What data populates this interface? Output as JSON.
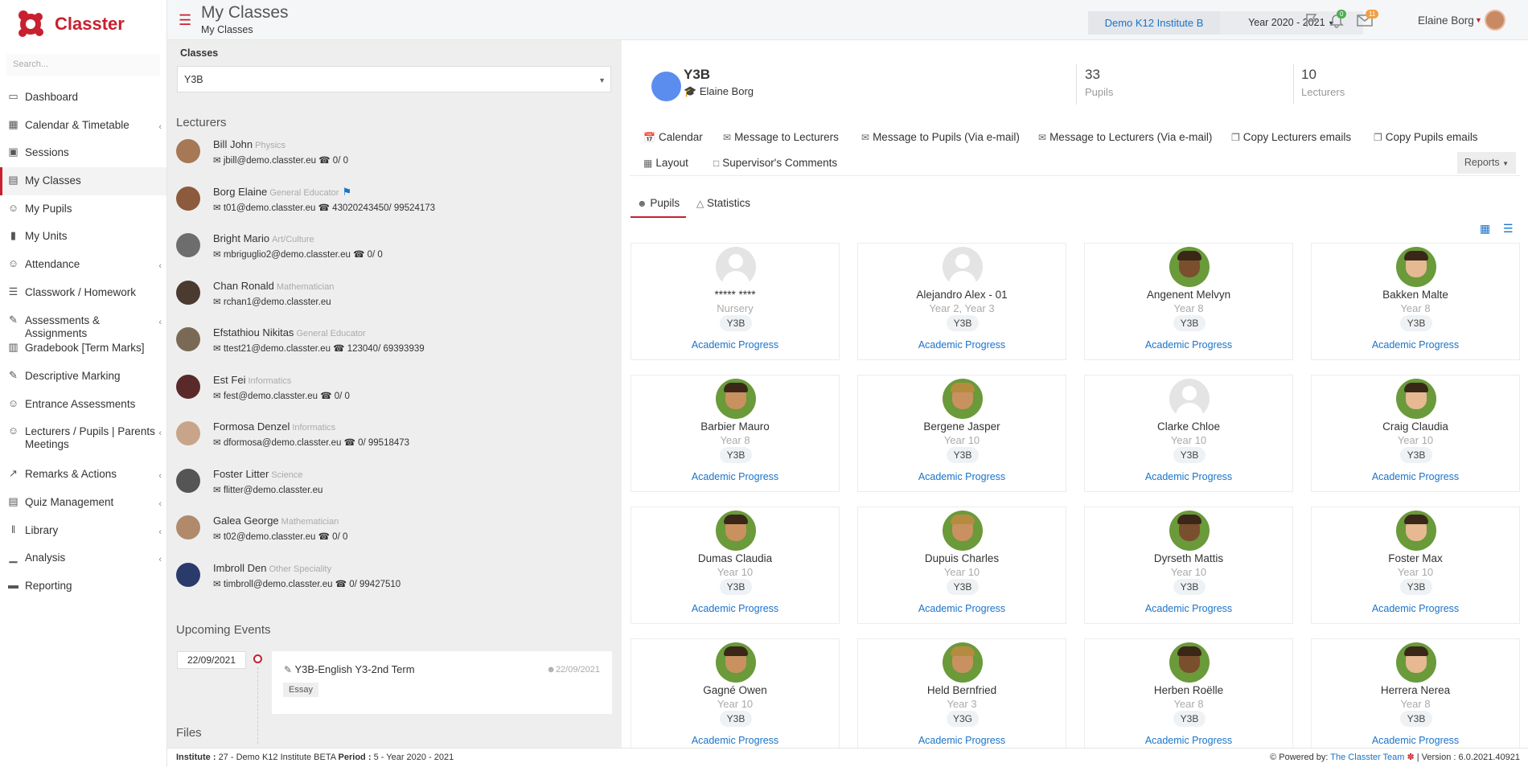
{
  "app": {
    "name": "Classter"
  },
  "search": {
    "placeholder": "Search..."
  },
  "sidebar": {
    "items": [
      {
        "label": "Dashboard",
        "icon": "monitor-icon",
        "chevron": false,
        "active": false
      },
      {
        "label": "Calendar & Timetable",
        "icon": "calendar-icon",
        "chevron": true,
        "active": false
      },
      {
        "label": "Sessions",
        "icon": "sessions-icon",
        "chevron": false,
        "active": false
      },
      {
        "label": "My Classes",
        "icon": "classroom-icon",
        "chevron": false,
        "active": true
      },
      {
        "label": "My Pupils",
        "icon": "users-icon",
        "chevron": false,
        "active": false
      },
      {
        "label": "My Units",
        "icon": "book-icon",
        "chevron": false,
        "active": false
      },
      {
        "label": "Attendance",
        "icon": "user-check-icon",
        "chevron": true,
        "active": false
      },
      {
        "label": "Classwork / Homework",
        "icon": "list-icon",
        "chevron": false,
        "active": false
      },
      {
        "label": "Assessments & Assignments",
        "icon": "edit-icon",
        "chevron": true,
        "active": false
      },
      {
        "label": "Gradebook [Term Marks]",
        "icon": "gradebook-icon",
        "chevron": false,
        "active": false
      },
      {
        "label": "Descriptive Marking",
        "icon": "pen-square-icon",
        "chevron": false,
        "active": false
      },
      {
        "label": "Entrance Assessments",
        "icon": "user-edit-icon",
        "chevron": false,
        "active": false
      },
      {
        "label": "Lecturers / Pupils | Parents Meetings",
        "icon": "meeting-icon",
        "chevron": true,
        "active": false
      },
      {
        "label": "Remarks & Actions",
        "icon": "remarks-icon",
        "chevron": true,
        "active": false
      },
      {
        "label": "Quiz Management",
        "icon": "quiz-icon",
        "chevron": true,
        "active": false
      },
      {
        "label": "Library",
        "icon": "library-icon",
        "chevron": true,
        "active": false
      },
      {
        "label": "Analysis",
        "icon": "bar-chart-icon",
        "chevron": true,
        "active": false
      },
      {
        "label": "Reporting",
        "icon": "printer-icon",
        "chevron": false,
        "active": false
      }
    ]
  },
  "header": {
    "title": "My Classes",
    "breadcrumb": "My Classes",
    "institute": "Demo K12 Institute B",
    "year": "Year 2020 - 2021",
    "notif_count": "0",
    "message_count": "11",
    "user_name": "Elaine Borg"
  },
  "left": {
    "classes_label": "Classes",
    "selected_class": "Y3B",
    "lecturers_title": "Lecturers",
    "lecturers": [
      {
        "name": "Bill John",
        "speciality": "Physics",
        "contact": "jbill@demo.classter.eu",
        "phone": "0/ 0",
        "supervisor": false
      },
      {
        "name": "Borg Elaine",
        "speciality": "General Educator",
        "contact": "t01@demo.classter.eu",
        "phone": "43020243450/ 99524173",
        "supervisor": true
      },
      {
        "name": "Bright Mario",
        "speciality": "Art/Culture",
        "contact": "mbriguglio2@demo.classter.eu",
        "phone": "0/ 0",
        "supervisor": false
      },
      {
        "name": "Chan Ronald",
        "speciality": "Mathematician",
        "contact": "rchan1@demo.classter.eu",
        "phone": "",
        "supervisor": false
      },
      {
        "name": "Efstathiou Nikitas",
        "speciality": "General Educator",
        "contact": "ttest21@demo.classter.eu",
        "phone": "123040/ 69393939",
        "supervisor": false
      },
      {
        "name": "Est Fei",
        "speciality": "Informatics",
        "contact": "fest@demo.classter.eu",
        "phone": "0/ 0",
        "supervisor": false
      },
      {
        "name": "Formosa Denzel",
        "speciality": "Informatics",
        "contact": "dformosa@demo.classter.eu",
        "phone": "0/ 99518473",
        "supervisor": false
      },
      {
        "name": "Foster Litter",
        "speciality": "Science",
        "contact": "flitter@demo.classter.eu",
        "phone": "",
        "supervisor": false
      },
      {
        "name": "Galea George",
        "speciality": "Mathematician",
        "contact": "t02@demo.classter.eu",
        "phone": "0/ 0",
        "supervisor": false
      },
      {
        "name": "Imbroll Den",
        "speciality": "Other Speciality",
        "contact": "timbroll@demo.classter.eu",
        "phone": "0/ 99427510",
        "supervisor": false
      }
    ],
    "events_title": "Upcoming Events",
    "event": {
      "date": "22/09/2021",
      "title": "Y3B-English Y3-2nd Term",
      "date2": "22/09/2021",
      "tag": "Essay"
    },
    "files_title": "Files"
  },
  "main": {
    "class_name": "Y3B",
    "supervisor": "Elaine Borg",
    "pupils_count": "33",
    "pupils_label": "Pupils",
    "lecturers_count": "10",
    "lecturers_label": "Lecturers",
    "actions": [
      {
        "label": "Calendar",
        "icon": "calendar-icon"
      },
      {
        "label": "Message to Lecturers",
        "icon": "envelope-icon"
      },
      {
        "label": "Message to Pupils (Via e-mail)",
        "icon": "mail-print-icon"
      },
      {
        "label": "Message to Lecturers (Via e-mail)",
        "icon": "mail-print-icon"
      },
      {
        "label": "Copy Lecturers emails",
        "icon": "copy-icon"
      },
      {
        "label": "Copy Pupils emails",
        "icon": "copy-icon"
      },
      {
        "label": "Layout",
        "icon": "layout-icon"
      },
      {
        "label": "Supervisor's Comments",
        "icon": "comment-icon"
      }
    ],
    "reports_label": "Reports",
    "tabs": [
      {
        "label": "Pupils",
        "icon": "users-icon",
        "active": true
      },
      {
        "label": "Statistics",
        "icon": "area-chart-icon",
        "active": false
      }
    ],
    "pupils": [
      {
        "name": "***** ****",
        "year": "Nursery",
        "class": "Y3B",
        "link": "Academic Progress",
        "photo": false
      },
      {
        "name": "Alejandro Alex - 01",
        "year": "Year 2, Year 3",
        "class": "Y3B",
        "link": "Academic Progress",
        "photo": false
      },
      {
        "name": "Angenent Melvyn",
        "year": "Year 8",
        "class": "Y3B",
        "link": "Academic Progress",
        "photo": true
      },
      {
        "name": "Bakken Malte",
        "year": "Year 8",
        "class": "Y3B",
        "link": "Academic Progress",
        "photo": true
      },
      {
        "name": "Barbier Mauro",
        "year": "Year 8",
        "class": "Y3B",
        "link": "Academic Progress",
        "photo": true
      },
      {
        "name": "Bergene Jasper",
        "year": "Year 10",
        "class": "Y3B",
        "link": "Academic Progress",
        "photo": true
      },
      {
        "name": "Clarke Chloe",
        "year": "Year 10",
        "class": "Y3B",
        "link": "Academic Progress",
        "photo": false
      },
      {
        "name": "Craig Claudia",
        "year": "Year 10",
        "class": "Y3B",
        "link": "Academic Progress",
        "photo": true
      },
      {
        "name": "Dumas Claudia",
        "year": "Year 10",
        "class": "Y3B",
        "link": "Academic Progress",
        "photo": true
      },
      {
        "name": "Dupuis Charles",
        "year": "Year 10",
        "class": "Y3B",
        "link": "Academic Progress",
        "photo": true
      },
      {
        "name": "Dyrseth Mattis",
        "year": "Year 10",
        "class": "Y3B",
        "link": "Academic Progress",
        "photo": true
      },
      {
        "name": "Foster Max",
        "year": "Year 10",
        "class": "Y3B",
        "link": "Academic Progress",
        "photo": true
      },
      {
        "name": "Gagné Owen",
        "year": "Year 10",
        "class": "Y3B",
        "link": "Academic Progress",
        "photo": true
      },
      {
        "name": "Held Bernfried",
        "year": "Year 3",
        "class": "Y3G",
        "link": "Academic Progress",
        "photo": true
      },
      {
        "name": "Herben Roëlle",
        "year": "Year 8",
        "class": "Y3B",
        "link": "Academic Progress",
        "photo": true
      },
      {
        "name": "Herrera Nerea",
        "year": "Year 8",
        "class": "Y3B",
        "link": "Academic Progress",
        "photo": true
      }
    ]
  },
  "footer": {
    "institute_label": "Institute :",
    "institute_value": "27 - Demo K12 Institute BETA",
    "period_label": "Period :",
    "period_value": "5 - Year 2020 - 2021",
    "powered_label": "Powered by:",
    "powered_link": "The Classter Team",
    "version": "| Version : 6.0.2021.40921"
  },
  "colors": {
    "accent": "#c8202f",
    "link": "#1a73c9",
    "class_circle": "#5b8def"
  }
}
